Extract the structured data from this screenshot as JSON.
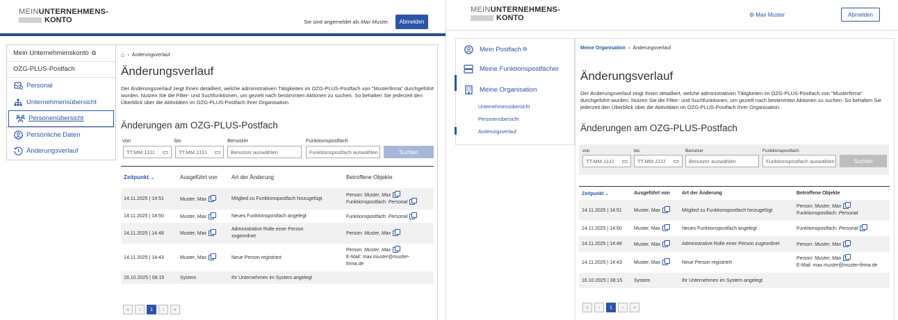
{
  "left": {
    "logo": {
      "line1_thin": "MEIN",
      "line1_bold": "UNTERNEHMENS-",
      "line2": "KONTO"
    },
    "signed_in_prefix": "Sie sind angemeldet als ",
    "signed_in_user": "Max Muster.",
    "logout_label": "Abmelden",
    "sidebar": {
      "top_link": "Mein Unternehmenskonto",
      "group_title": "OZG-PLUS-Postfach",
      "items": [
        {
          "label": "Personal",
          "icon": "inbox-icon"
        },
        {
          "label": "Unternehmensübersicht",
          "icon": "org-chart-icon"
        },
        {
          "label": "Personenübersicht",
          "icon": "people-icon"
        },
        {
          "label": "Persönliche Daten",
          "icon": "user-circle-icon"
        },
        {
          "label": "Änderungsverlauf",
          "icon": "history-icon"
        }
      ]
    },
    "breadcrumb_current": "Änderungsverlauf",
    "title": "Änderungsverlauf",
    "intro": "Der Änderungsverlauf zeigt Ihnen detailliert, welche administrativen Tätigkeiten im OZG-PLUS-Postfach von \"Musterfirma\" durchgeführt wurden. Nutzen Sie die Filter- und Suchfunktionen, um gezielt nach bestimmten Aktionen zu suchen. So behalten Sie jederzeit den Überblick über die Aktivitäten im OZG-PLUS-Postfach Ihrer Organisation.",
    "subtitle": "Änderungen am OZG-PLUS-Postfach"
  },
  "filters": {
    "from_label": "von",
    "to_label": "bis",
    "user_label": "Benutzer",
    "fp_label": "Funktionspostfach",
    "date_placeholder": "TT.MM.JJJJ",
    "user_placeholder": "Benutzer auswählen",
    "fp_placeholder": "Funktionspostfach auswählen",
    "search_label": "Suchen"
  },
  "table": {
    "headers": {
      "time": "Zeitpunkt",
      "by": "Ausgeführt von",
      "kind": "Art der Änderung",
      "objects": "Betroffene Objekte"
    },
    "rows": [
      {
        "time": "14.11.2025 | 14:51",
        "by": "Muster, Max",
        "kind": "Mitglied zu Funktionspostfach hinzugefügt",
        "obj1_prefix": "Person: ",
        "obj1_val": "Muster, Max",
        "obj2_prefix": "Funktionspostfach: ",
        "obj2_val": "Personal"
      },
      {
        "time": "14.11.2025 | 14:50",
        "by": "Muster, Max",
        "kind": "Neues Funktionspostfach angelegt",
        "obj1_prefix": "Funktionspostfach: ",
        "obj1_val": "Personal"
      },
      {
        "time": "14.11.2025 | 14:48",
        "by": "Muster, Max",
        "kind": "Administrative Rolle einer Person zugeordnet",
        "obj1_prefix": "Person: ",
        "obj1_val": "Muster, Max"
      },
      {
        "time": "14.11.2025 | 14:43",
        "by": "Muster, Max",
        "kind": "Neue Person registriert",
        "obj1_prefix": "Person: ",
        "obj1_val": "Muster, Max",
        "obj2_prefix": "E-Mail: ",
        "obj2_val": "max.muster@muster-firma.de"
      },
      {
        "time": "16.10.2025 | 08:15",
        "by": "System",
        "kind": "Ihr Unternehmen im System angelegt"
      }
    ]
  },
  "pager": {
    "first": "«",
    "prev": "‹",
    "current": "1",
    "next": "›",
    "last": "»"
  },
  "right": {
    "user": "Max Muster",
    "logout_label": "Abmelden",
    "nav": [
      {
        "label": "Mein Postfach",
        "icon": "postbox-icon"
      },
      {
        "label": "Meine Funktionspostfächer",
        "icon": "stack-icon"
      },
      {
        "label": "Meine Organisation",
        "icon": "building-icon"
      }
    ],
    "subnav": [
      "Unternehmensübersicht",
      "Personenübersicht",
      "Änderungsverlauf"
    ],
    "breadcrumb_root": "Meine Organisation",
    "breadcrumb_current": "Änderungsverlauf"
  },
  "colors": {
    "accent": "#2c54a8",
    "header_rule": "#2d4c8f",
    "disabled_button": "#a8b6d8",
    "row_alt": "#f1f1f1"
  }
}
